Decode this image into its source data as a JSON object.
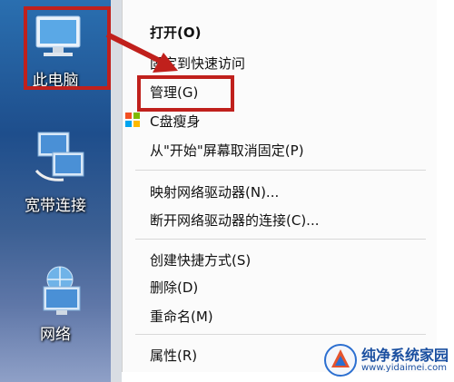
{
  "desktop": {
    "icons": [
      {
        "label": "此电脑",
        "icon": "computer-icon"
      },
      {
        "label": "宽带连接",
        "icon": "network-connection-icon"
      },
      {
        "label": "网络",
        "icon": "network-globe-icon"
      }
    ]
  },
  "menu": {
    "items": [
      {
        "label": "打开(O)"
      },
      {
        "label": "固定到快速访问"
      },
      {
        "label": "管理(G)"
      },
      {
        "label": "C盘瘦身"
      },
      {
        "label": "从\"开始\"屏幕取消固定(P)"
      },
      {
        "label": "映射网络驱动器(N)..."
      },
      {
        "label": "断开网络驱动器的连接(C)..."
      },
      {
        "label": "创建快捷方式(S)"
      },
      {
        "label": "删除(D)"
      },
      {
        "label": "重命名(M)"
      },
      {
        "label": "属性(R)"
      }
    ]
  },
  "watermark": {
    "title": "纯净系统家园",
    "url": "www.yidaimei.com"
  },
  "colors": {
    "highlight": "#c0201c",
    "menu_bg": "#fbfbfb"
  }
}
